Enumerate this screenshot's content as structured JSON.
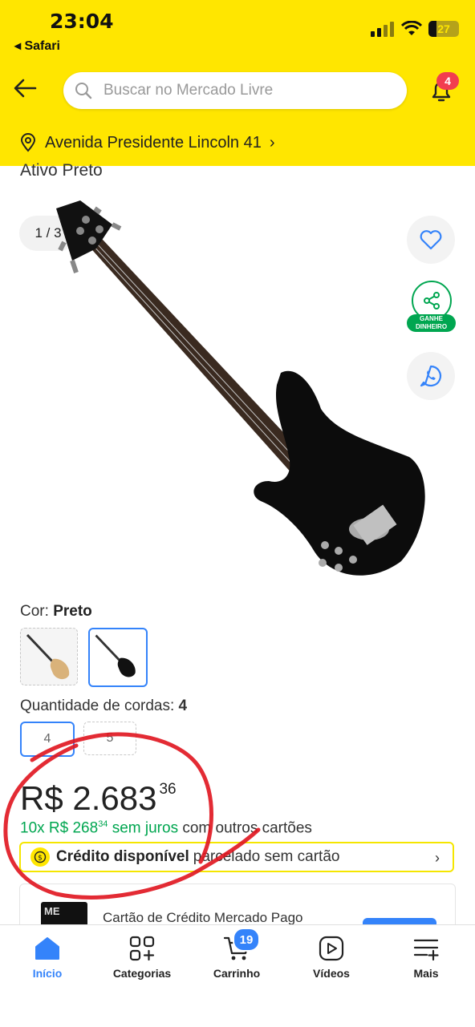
{
  "status_bar": {
    "time": "23:04",
    "back_app": "Safari",
    "battery": "27"
  },
  "header": {
    "search_placeholder": "Buscar no Mercado Livre",
    "notifications_count": "4",
    "address": "Avenida Presidente Lincoln 41"
  },
  "product": {
    "title_fragment": "Ativo Preto",
    "gallery_counter": "1 / 3",
    "share_label": "GANHE DINHEIRO",
    "color_label": "Cor:",
    "color_value": "Preto",
    "strings_label": "Quantidade de cordas:",
    "strings_value": "4",
    "string_options": [
      "4",
      "5"
    ],
    "price_main": "R$ 2.683",
    "price_cents": "36",
    "installments_prefix": "10x R$ 268",
    "installments_cents": "34",
    "installments_green": "sem juros",
    "installments_rest": "com outros cartões",
    "credit_bold": "Crédito disponível",
    "credit_rest": "parcelado sem cartão",
    "card_text": "Cartão de Crédito Mercado Pago",
    "card_image_text": "ME"
  },
  "bottom_nav": {
    "items": [
      {
        "label": "Início",
        "icon": "home-icon"
      },
      {
        "label": "Categorias",
        "icon": "categories-icon"
      },
      {
        "label": "Carrinho",
        "icon": "cart-icon"
      },
      {
        "label": "Vídeos",
        "icon": "play-icon"
      },
      {
        "label": "Mais",
        "icon": "menu-plus-icon"
      }
    ],
    "cart_count": "19"
  },
  "colors": {
    "header_yellow": "#ffe600",
    "accent_blue": "#3483fa",
    "green": "#00a650",
    "badge_red": "#f23d4f",
    "scribble_red": "#e0141e"
  }
}
